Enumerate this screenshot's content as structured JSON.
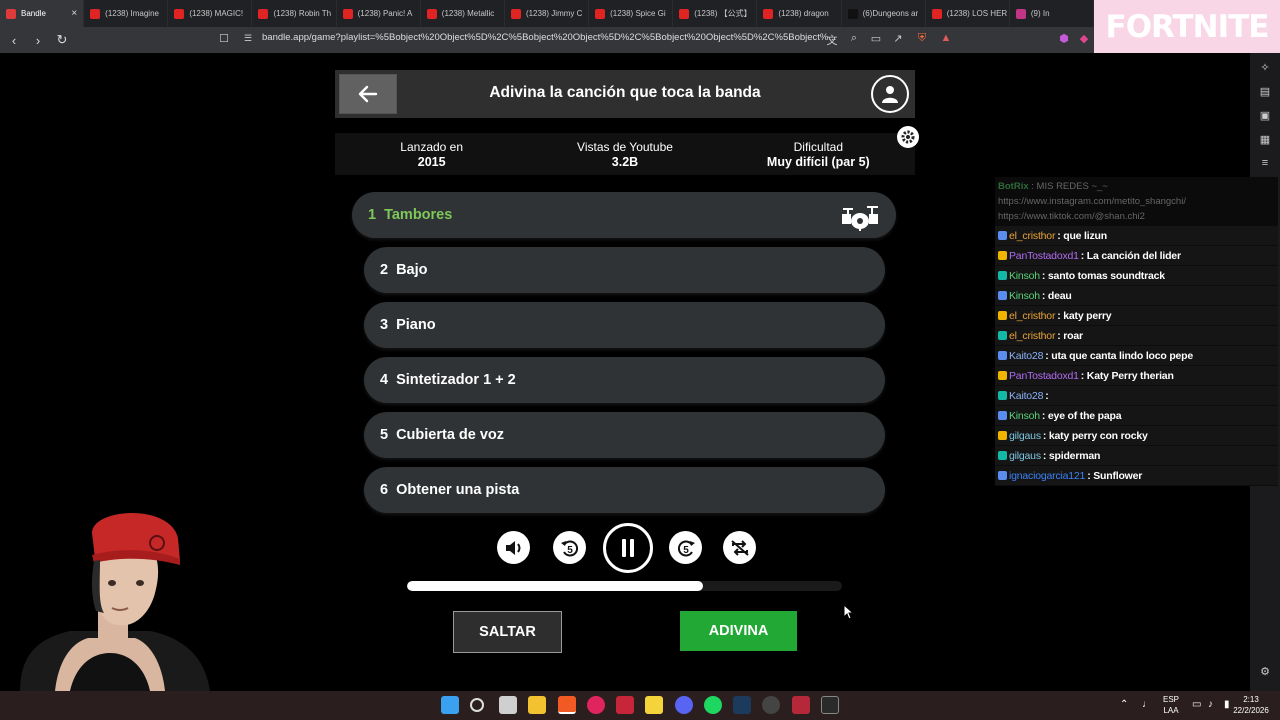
{
  "browser": {
    "tabs": [
      {
        "label": "Bandle",
        "color": "#e03b3b",
        "active": true
      },
      {
        "label": "(1238) Imagine",
        "color": "#e02424"
      },
      {
        "label": "(1238) MAGIC!",
        "color": "#e02424"
      },
      {
        "label": "(1238) Robin Th",
        "color": "#e02424"
      },
      {
        "label": "(1238) Panic! A",
        "color": "#e02424"
      },
      {
        "label": "(1238) Metallic",
        "color": "#e02424"
      },
      {
        "label": "(1238) Jimmy C",
        "color": "#e02424"
      },
      {
        "label": "(1238) Spice Gi",
        "color": "#e02424"
      },
      {
        "label": "(1238) 【公式】",
        "color": "#e02424"
      },
      {
        "label": "(1238) dragon",
        "color": "#e02424"
      },
      {
        "label": "(6)Dungeons ar",
        "color": "#111111"
      },
      {
        "label": "(1238) LOS HER",
        "color": "#e02424"
      },
      {
        "label": "(9) In",
        "color": "#c13584"
      }
    ],
    "url": "bandle.app/game?playlist=%5Bobject%20Object%5D%2C%5Bobject%20Object%5D%2C%5Bobject%20Object%5D%2C%5Bobject%...",
    "ad_text": "FORTNITE"
  },
  "game": {
    "title": "Adivina la canción que toca la banda",
    "info": [
      {
        "label": "Lanzado en",
        "value": "2015"
      },
      {
        "label": "Vistas de Youtube",
        "value": "3.2B"
      },
      {
        "label": "Dificultad",
        "value": "Muy difícil (par 5)"
      }
    ],
    "instruments": [
      {
        "num": "1",
        "label": "Tambores",
        "active": true
      },
      {
        "num": "2",
        "label": "Bajo"
      },
      {
        "num": "3",
        "label": "Piano"
      },
      {
        "num": "4",
        "label": "Sintetizador 1 + 2"
      },
      {
        "num": "5",
        "label": "Cubierta de voz"
      },
      {
        "num": "6",
        "label": "Obtener una pista"
      }
    ],
    "controls": {
      "rewind_seconds": "5",
      "forward_seconds": "5"
    },
    "progress": 0.68,
    "skip_label": "SALTAR",
    "guess_label": "ADIVINA"
  },
  "chat": {
    "bot": {
      "name": "BotRix",
      "text": ": MIS REDES ~_~ https://www.instagram.com/metito_shangchi/ https://www.tiktok.com/@shan.chi2"
    },
    "messages": [
      {
        "user": "el_cristhor",
        "color": "#e8a33a",
        "text": ": que lizun"
      },
      {
        "user": "PanTostadoxd1",
        "color": "#b26cf0",
        "text": ": La canción del lider"
      },
      {
        "user": "Kinsoh",
        "color": "#5ad17a",
        "text": ": santo tomas soundtrack"
      },
      {
        "user": "Kinsoh",
        "color": "#5ad17a",
        "text": ": deau"
      },
      {
        "user": "el_cristhor",
        "color": "#e8a33a",
        "text": ": katy perry"
      },
      {
        "user": "el_cristhor",
        "color": "#e8a33a",
        "text": ": roar"
      },
      {
        "user": "Kaito28",
        "color": "#8ab4f8",
        "text": ": uta que canta lindo loco pepe"
      },
      {
        "user": "PanTostadoxd1",
        "color": "#b26cf0",
        "text": ": Katy Perry therian"
      },
      {
        "user": "Kaito28",
        "color": "#8ab4f8",
        "text": ":"
      },
      {
        "user": "Kinsoh",
        "color": "#5ad17a",
        "text": ": eye of the papa"
      },
      {
        "user": "gilgaus",
        "color": "#7ec8e3",
        "text": ": katy perry con rocky"
      },
      {
        "user": "gilgaus",
        "color": "#7ec8e3",
        "text": ": spiderman"
      },
      {
        "user": "ignaciogarcia121",
        "color": "#3b82f6",
        "text": ": Sunflower"
      }
    ]
  },
  "taskbar": {
    "lang": "ESP",
    "layout": "LAA",
    "time": "2:13",
    "date": "22/2/2026"
  }
}
